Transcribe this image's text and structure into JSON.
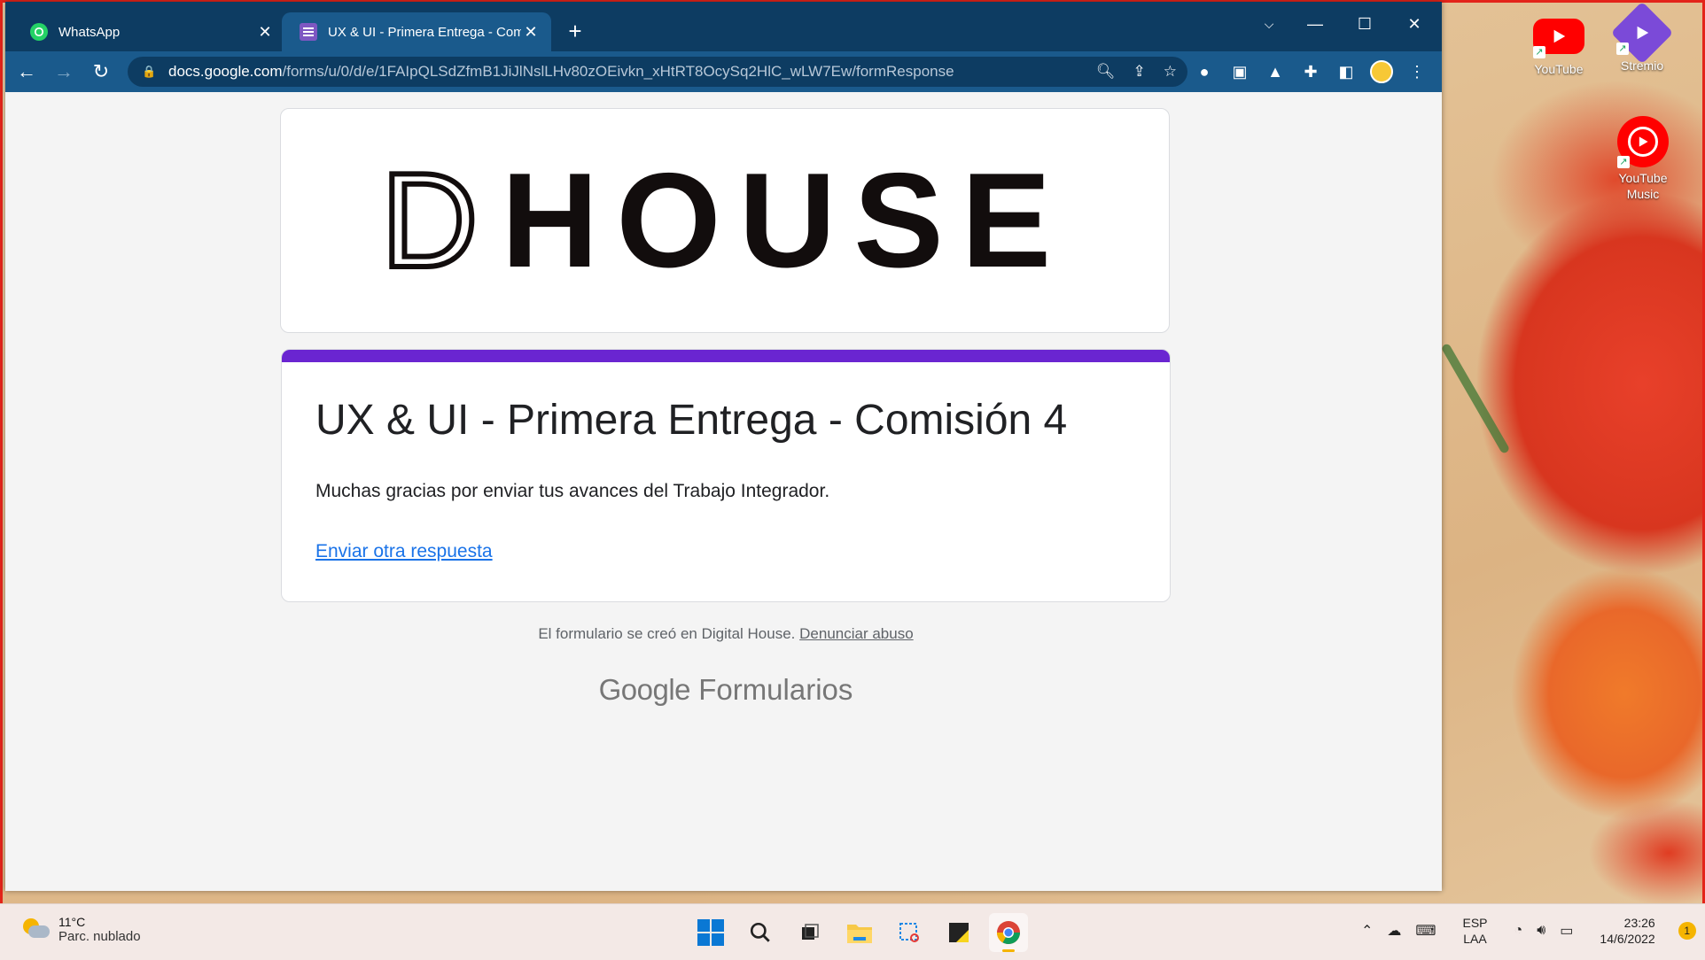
{
  "window": {
    "tabs": [
      {
        "label": "WhatsApp",
        "favicon": "whatsapp-icon",
        "active": false
      },
      {
        "label": "UX & UI - Primera Entrega - Com",
        "favicon": "google-forms-icon",
        "active": true
      }
    ],
    "new_tab_label": "+"
  },
  "address_bar": {
    "domain": "docs.google.com",
    "path": "/forms/u/0/d/e/1FAIpQLSdZfmB1JiJlNslLHv80zOEivkn_xHtRT8OcySq2HlC_wLW7Ew/formResponse"
  },
  "page": {
    "logo": {
      "first": "D",
      "rest": "HOUSE"
    },
    "form_title": "UX & UI - Primera Entrega - Comisión 4",
    "confirmation_message": "Muchas gracias por enviar tus avances del Trabajo Integrador.",
    "resubmit_link": "Enviar otra respuesta",
    "footer_text": "El formulario se creó en Digital House.",
    "footer_abuse_link": "Denunciar abuso",
    "brand_google": "Google",
    "brand_product": "Formularios",
    "accent_color": "#6a25d1",
    "link_color": "#1a73e8"
  },
  "desktop": {
    "icons": [
      {
        "label": "YouTube",
        "icon": "youtube-icon"
      },
      {
        "label": "Stremio",
        "icon": "stremio-icon"
      },
      {
        "label": "YouTube Music",
        "icon": "youtube-music-icon"
      }
    ]
  },
  "taskbar": {
    "weather_temp": "11°C",
    "weather_desc": "Parc. nublado",
    "lang_line1": "ESP",
    "lang_line2": "LAA",
    "time": "23:26",
    "date": "14/6/2022",
    "notification_count": "1"
  },
  "colors": {
    "tabstrip": "#0d3c62",
    "toolbar": "#1a5a8c"
  }
}
